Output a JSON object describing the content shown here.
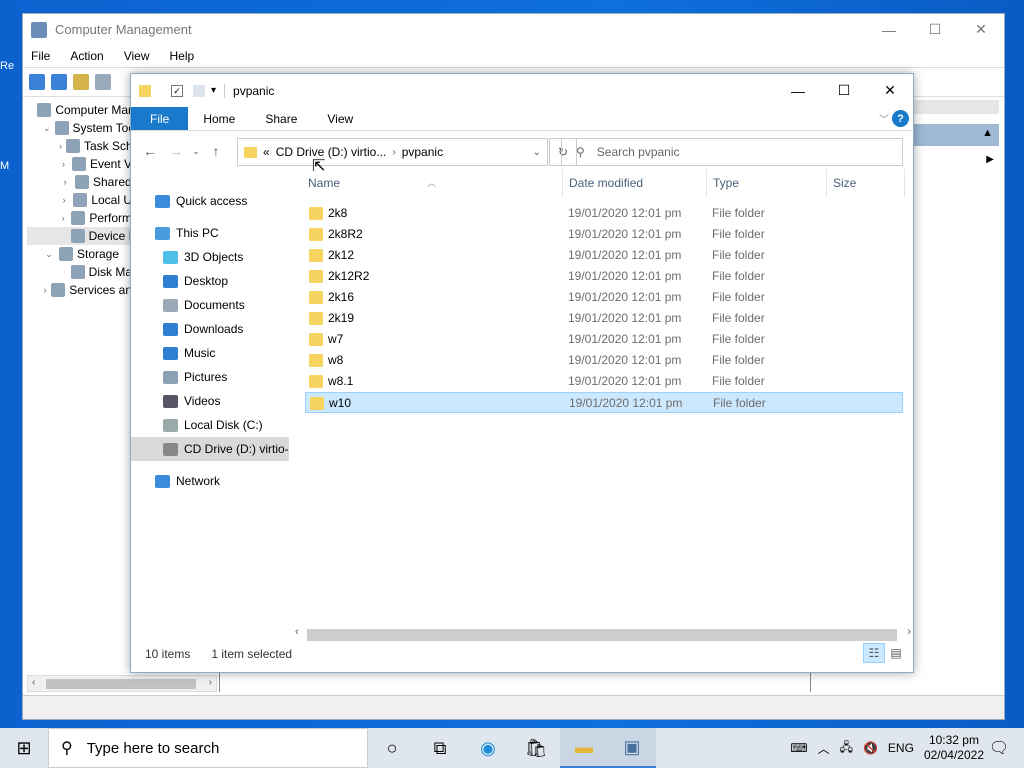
{
  "desktop": {
    "icon1_label": "Re",
    "icon2_label": "M"
  },
  "cm": {
    "title": "Computer Management",
    "menu": [
      "File",
      "Action",
      "View",
      "Help"
    ],
    "tree": [
      {
        "label": "Computer Mar",
        "level": 0,
        "expander": "",
        "icon": "computer-management-icon"
      },
      {
        "label": "System Too",
        "level": 1,
        "expander": "v",
        "icon": "tools-icon"
      },
      {
        "label": "Task Sch",
        "level": 2,
        "expander": ">",
        "icon": "clock-icon"
      },
      {
        "label": "Event V",
        "level": 2,
        "expander": ">",
        "icon": "event-viewer-icon"
      },
      {
        "label": "Shared",
        "level": 2,
        "expander": ">",
        "icon": "shared-folder-icon"
      },
      {
        "label": "Local U",
        "level": 2,
        "expander": ">",
        "icon": "users-icon"
      },
      {
        "label": "Perform",
        "level": 2,
        "expander": ">",
        "icon": "performance-icon"
      },
      {
        "label": "Device I",
        "level": 2,
        "expander": "",
        "icon": "device-manager-icon",
        "selected": true
      },
      {
        "label": "Storage",
        "level": 1,
        "expander": "v",
        "icon": "storage-icon"
      },
      {
        "label": "Disk Ma",
        "level": 2,
        "expander": "",
        "icon": "disk-icon"
      },
      {
        "label": "Services an",
        "level": 1,
        "expander": ">",
        "icon": "services-icon"
      }
    ]
  },
  "explorer": {
    "title": "pvpanic",
    "ribbon_tabs": [
      "File",
      "Home",
      "Share",
      "View"
    ],
    "address": {
      "prefix": "«",
      "drive": "CD Drive (D:) virtio...",
      "folder": "pvpanic"
    },
    "search_placeholder": "Search pvpanic",
    "nav": [
      {
        "label": "Quick access",
        "indent": 24,
        "icon": "star-icon",
        "color": "#3c8cdc"
      },
      {
        "label": "This PC",
        "indent": 24,
        "icon": "pc-icon",
        "color": "#4a9be0"
      },
      {
        "label": "3D Objects",
        "indent": 32,
        "icon": "3d-objects-icon",
        "color": "#4ec0e8"
      },
      {
        "label": "Desktop",
        "indent": 32,
        "icon": "desktop-icon",
        "color": "#2f7fd0"
      },
      {
        "label": "Documents",
        "indent": 32,
        "icon": "documents-icon",
        "color": "#9aa8b8"
      },
      {
        "label": "Downloads",
        "indent": 32,
        "icon": "downloads-icon",
        "color": "#2f7fd0"
      },
      {
        "label": "Music",
        "indent": 32,
        "icon": "music-icon",
        "color": "#2f7fd0"
      },
      {
        "label": "Pictures",
        "indent": 32,
        "icon": "pictures-icon",
        "color": "#8ca0b6"
      },
      {
        "label": "Videos",
        "indent": 32,
        "icon": "videos-icon",
        "color": "#556"
      },
      {
        "label": "Local Disk (C:)",
        "indent": 32,
        "icon": "local-disk-icon",
        "color": "#9aa"
      },
      {
        "label": "CD Drive (D:) virtio-",
        "indent": 32,
        "icon": "cd-drive-icon",
        "color": "#888",
        "selected": true
      },
      {
        "label": "Network",
        "indent": 24,
        "icon": "network-icon",
        "color": "#3c8cdc"
      }
    ],
    "columns": {
      "name": "Name",
      "date": "Date modified",
      "type": "Type",
      "size": "Size"
    },
    "files": [
      {
        "name": "2k8",
        "date": "19/01/2020 12:01 pm",
        "type": "File folder"
      },
      {
        "name": "2k8R2",
        "date": "19/01/2020 12:01 pm",
        "type": "File folder"
      },
      {
        "name": "2k12",
        "date": "19/01/2020 12:01 pm",
        "type": "File folder"
      },
      {
        "name": "2k12R2",
        "date": "19/01/2020 12:01 pm",
        "type": "File folder"
      },
      {
        "name": "2k16",
        "date": "19/01/2020 12:01 pm",
        "type": "File folder"
      },
      {
        "name": "2k19",
        "date": "19/01/2020 12:01 pm",
        "type": "File folder"
      },
      {
        "name": "w7",
        "date": "19/01/2020 12:01 pm",
        "type": "File folder"
      },
      {
        "name": "w8",
        "date": "19/01/2020 12:01 pm",
        "type": "File folder"
      },
      {
        "name": "w8.1",
        "date": "19/01/2020 12:01 pm",
        "type": "File folder"
      },
      {
        "name": "w10",
        "date": "19/01/2020 12:01 pm",
        "type": "File folder",
        "selected": true
      }
    ],
    "status": {
      "count": "10 items",
      "selection": "1 item selected"
    }
  },
  "taskbar": {
    "search_placeholder": "Type here to search",
    "language": "ENG",
    "time": "10:32 pm",
    "date": "02/04/2022"
  }
}
